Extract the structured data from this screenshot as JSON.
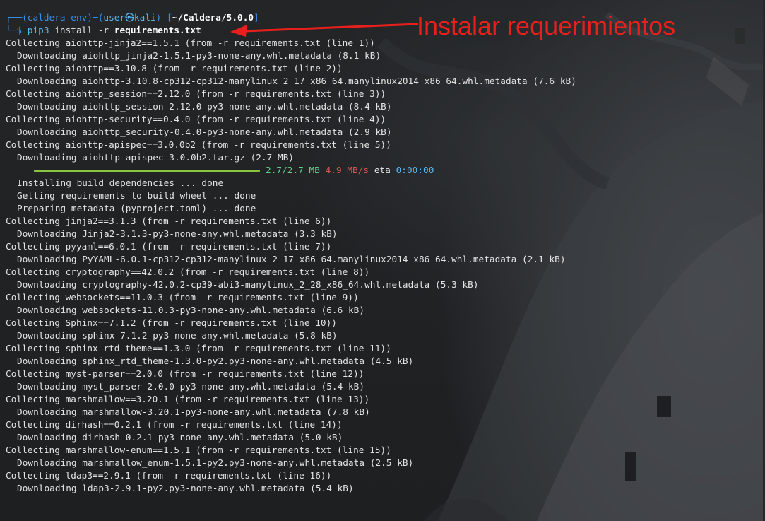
{
  "prompt": {
    "env": "(caldera-env)",
    "user_host": "user㉿kali",
    "path": "~/Caldera/5.0.0",
    "command": "pip3",
    "args": " install -r ",
    "file": "requirements.txt"
  },
  "annotation": {
    "text": "Instalar requerimientos",
    "color": "#e8201d"
  },
  "output_lines": {
    "l1": "Collecting aiohttp-jinja2==1.5.1 (from -r requirements.txt (line 1))",
    "l2": "Downloading aiohttp_jinja2-1.5.1-py3-none-any.whl.metadata (8.1 kB)",
    "l3": "Collecting aiohttp==3.10.8 (from -r requirements.txt (line 2))",
    "l4": "Downloading aiohttp-3.10.8-cp312-cp312-manylinux_2_17_x86_64.manylinux2014_x86_64.whl.metadata (7.6 kB)",
    "l5": "Collecting aiohttp_session==2.12.0 (from -r requirements.txt (line 3))",
    "l6": "Downloading aiohttp_session-2.12.0-py3-none-any.whl.metadata (8.4 kB)",
    "l7": "Collecting aiohttp-security==0.4.0 (from -r requirements.txt (line 4))",
    "l8": "Downloading aiohttp_security-0.4.0-py3-none-any.whl.metadata (2.9 kB)",
    "l9": "Collecting aiohttp-apispec==3.0.0b2 (from -r requirements.txt (line 5))",
    "l10": "Downloading aiohttp-apispec-3.0.0b2.tar.gz (2.7 MB)",
    "l12": "Installing build dependencies ... done",
    "l13": "Getting requirements to build wheel ... done",
    "l14": "Preparing metadata (pyproject.toml) ... done",
    "l15": "Collecting jinja2==3.1.3 (from -r requirements.txt (line 6))",
    "l16": "Downloading Jinja2-3.1.3-py3-none-any.whl.metadata (3.3 kB)",
    "l17": "Collecting pyyaml==6.0.1 (from -r requirements.txt (line 7))",
    "l18": "Downloading PyYAML-6.0.1-cp312-cp312-manylinux_2_17_x86_64.manylinux2014_x86_64.whl.metadata (2.1 kB)",
    "l19": "Collecting cryptography==42.0.2 (from -r requirements.txt (line 8))",
    "l20": "Downloading cryptography-42.0.2-cp39-abi3-manylinux_2_28_x86_64.whl.metadata (5.3 kB)",
    "l21": "Collecting websockets==11.0.3 (from -r requirements.txt (line 9))",
    "l22": "Downloading websockets-11.0.3-py3-none-any.whl.metadata (6.6 kB)",
    "l23": "Collecting Sphinx==7.1.2 (from -r requirements.txt (line 10))",
    "l24": "Downloading sphinx-7.1.2-py3-none-any.whl.metadata (5.8 kB)",
    "l25": "Collecting sphinx_rtd_theme==1.3.0 (from -r requirements.txt (line 11))",
    "l26": "Downloading sphinx_rtd_theme-1.3.0-py2.py3-none-any.whl.metadata (4.5 kB)",
    "l27": "Collecting myst-parser==2.0.0 (from -r requirements.txt (line 12))",
    "l28": "Downloading myst_parser-2.0.0-py3-none-any.whl.metadata (5.4 kB)",
    "l29": "Collecting marshmallow==3.20.1 (from -r requirements.txt (line 13))",
    "l30": "Downloading marshmallow-3.20.1-py3-none-any.whl.metadata (7.8 kB)",
    "l31": "Collecting dirhash==0.2.1 (from -r requirements.txt (line 14))",
    "l32": "Downloading dirhash-0.2.1-py3-none-any.whl.metadata (5.0 kB)",
    "l33": "Collecting marshmallow-enum==1.5.1 (from -r requirements.txt (line 15))",
    "l34": "Downloading marshmallow_enum-1.5.1-py2.py3-none-any.whl.metadata (2.5 kB)",
    "l35": "Collecting ldap3==2.9.1 (from -r requirements.txt (line 16))",
    "l36": "Downloading ldap3-2.9.1-py2.py3-none-any.whl.metadata (5.4 kB)"
  },
  "progress": {
    "fraction": 1.0,
    "size": "2.7/2.7 MB",
    "speed": "4.9 MB/s",
    "eta_label": "eta",
    "eta_value": "0:00:00",
    "bar_color": "#89c540"
  },
  "colors": {
    "prompt_blue": "#3b8eea",
    "text": "#e3e3e3",
    "size_green": "#5fd38d",
    "speed_red": "#d9534f"
  }
}
